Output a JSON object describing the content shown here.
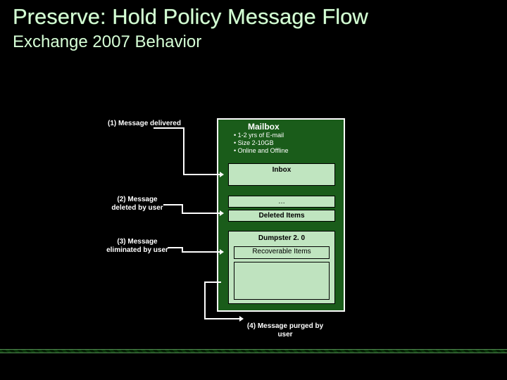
{
  "title": "Preserve: Hold Policy Message Flow",
  "subtitle": "Exchange 2007 Behavior",
  "steps": [
    "(1) Message delivered",
    "(2) Message deleted by user",
    "(3) Message eliminated by user",
    "(4) Message purged by user"
  ],
  "mailbox": {
    "title": "Mailbox",
    "bullets": [
      "• 1-2 yrs of E-mail",
      "• Size 2-10GB",
      "• Online and Offline"
    ],
    "inbox": "Inbox",
    "ellipsis": "…",
    "deleted_items": "Deleted Items",
    "dumpster_title": "Dumpster 2. 0",
    "recoverable_items": "Recoverable Items"
  },
  "colors": {
    "bg": "#000000",
    "heading": "#d6ffd6",
    "mailbox_fill": "#1a5c1a",
    "box_fill": "#c0e5c0",
    "border": "#ffffff"
  }
}
